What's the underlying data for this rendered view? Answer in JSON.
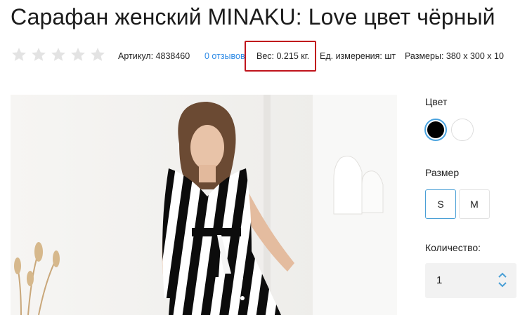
{
  "product": {
    "title": "Сарафан женский MINAKU: Love цвет чёрный"
  },
  "meta": {
    "rating_stars": 5,
    "article": "Артикул: 4838460",
    "reviews": "0 отзывов",
    "weight": "Вес: 0.215 кг.",
    "unit": "Ед. измерения: шт",
    "dimensions": "Размеры: 380 x 300 x 10"
  },
  "options": {
    "color_label": "Цвет",
    "colors": [
      {
        "name": "black",
        "hex": "#000000",
        "selected": true
      },
      {
        "name": "white",
        "hex": "#ffffff",
        "selected": false
      }
    ],
    "size_label": "Размер",
    "sizes": [
      {
        "label": "S",
        "selected": true
      },
      {
        "label": "M",
        "selected": false
      }
    ],
    "quantity_label": "Количество:",
    "quantity_value": "1"
  },
  "colors": {
    "accent": "#4a9fd6",
    "link": "#2f8be6",
    "highlight_box": "#c0141c"
  }
}
